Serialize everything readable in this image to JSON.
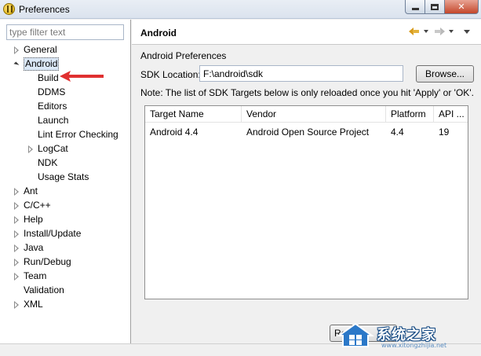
{
  "window": {
    "title": "Preferences"
  },
  "left_pane": {
    "filter_placeholder": "type filter text",
    "tree": [
      {
        "label": "General",
        "level": 0,
        "state": "collapsed"
      },
      {
        "label": "Android",
        "level": 0,
        "state": "expanded",
        "selected": true
      },
      {
        "label": "Build",
        "level": 1,
        "state": "leaf"
      },
      {
        "label": "DDMS",
        "level": 1,
        "state": "leaf"
      },
      {
        "label": "Editors",
        "level": 1,
        "state": "leaf"
      },
      {
        "label": "Launch",
        "level": 1,
        "state": "leaf"
      },
      {
        "label": "Lint Error Checking",
        "level": 1,
        "state": "leaf"
      },
      {
        "label": "LogCat",
        "level": 1,
        "state": "collapsed"
      },
      {
        "label": "NDK",
        "level": 1,
        "state": "leaf"
      },
      {
        "label": "Usage Stats",
        "level": 1,
        "state": "leaf"
      },
      {
        "label": "Ant",
        "level": 0,
        "state": "collapsed"
      },
      {
        "label": "C/C++",
        "level": 0,
        "state": "collapsed"
      },
      {
        "label": "Help",
        "level": 0,
        "state": "collapsed"
      },
      {
        "label": "Install/Update",
        "level": 0,
        "state": "collapsed"
      },
      {
        "label": "Java",
        "level": 0,
        "state": "collapsed"
      },
      {
        "label": "Run/Debug",
        "level": 0,
        "state": "collapsed"
      },
      {
        "label": "Team",
        "level": 0,
        "state": "collapsed"
      },
      {
        "label": "Validation",
        "level": 0,
        "state": "leaf"
      },
      {
        "label": "XML",
        "level": 0,
        "state": "collapsed"
      }
    ]
  },
  "right_pane": {
    "header_title": "Android",
    "section_label": "Android Preferences",
    "sdk_location_label": "SDK Location:",
    "sdk_location_value": "F:\\android\\sdk",
    "browse_label": "Browse...",
    "note": "Note: The list of SDK Targets below is only reloaded once you hit 'Apply' or 'OK'.",
    "table": {
      "columns": [
        "Target Name",
        "Vendor",
        "Platform",
        "API ..."
      ],
      "rows": [
        [
          "Android 4.4",
          "Android Open Source Project",
          "4.4",
          "19"
        ]
      ]
    },
    "restore_label": "Restore Defaults"
  },
  "watermark": {
    "text": "系统之家",
    "url": "www.xitongzhijia.net"
  },
  "colors": {
    "accent_arrow": "#e03030",
    "selection_bg": "#dbe8f7"
  }
}
